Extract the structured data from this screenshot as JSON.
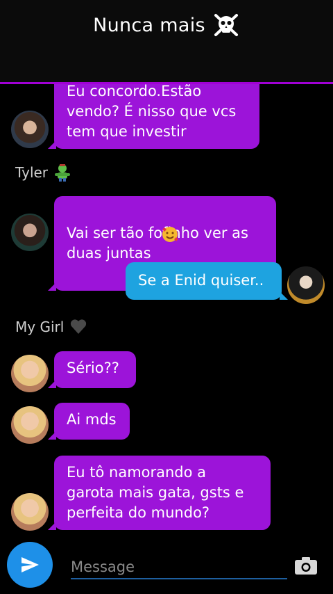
{
  "header": {
    "title": "Nunca mais",
    "title_icon": "skull-crossbones-icon",
    "accent": "#a100d6"
  },
  "colors": {
    "incoming_bubble": "#9c14d9",
    "outgoing_bubble": "#1ea3e0",
    "send_button": "#1e90e8"
  },
  "messages": [
    {
      "text": "Eu concordo.Estão\nvendo? É nisso que vcs\ntem que investir"
    },
    {
      "sender": "Tyler"
    },
    {
      "text": "Vai ser tão fofinho ver as\nduas juntas"
    },
    {
      "text": "Se a Enid quiser.."
    },
    {
      "sender": "My Girl"
    },
    {
      "text": "Sério??"
    },
    {
      "text": "Ai mds"
    },
    {
      "text": "Eu tô namorando a\ngarota mais gata, gsts e\nperfeita do mundo?"
    }
  ],
  "composer": {
    "placeholder": "Message",
    "send_icon": "send-icon",
    "camera_icon": "camera-icon"
  }
}
